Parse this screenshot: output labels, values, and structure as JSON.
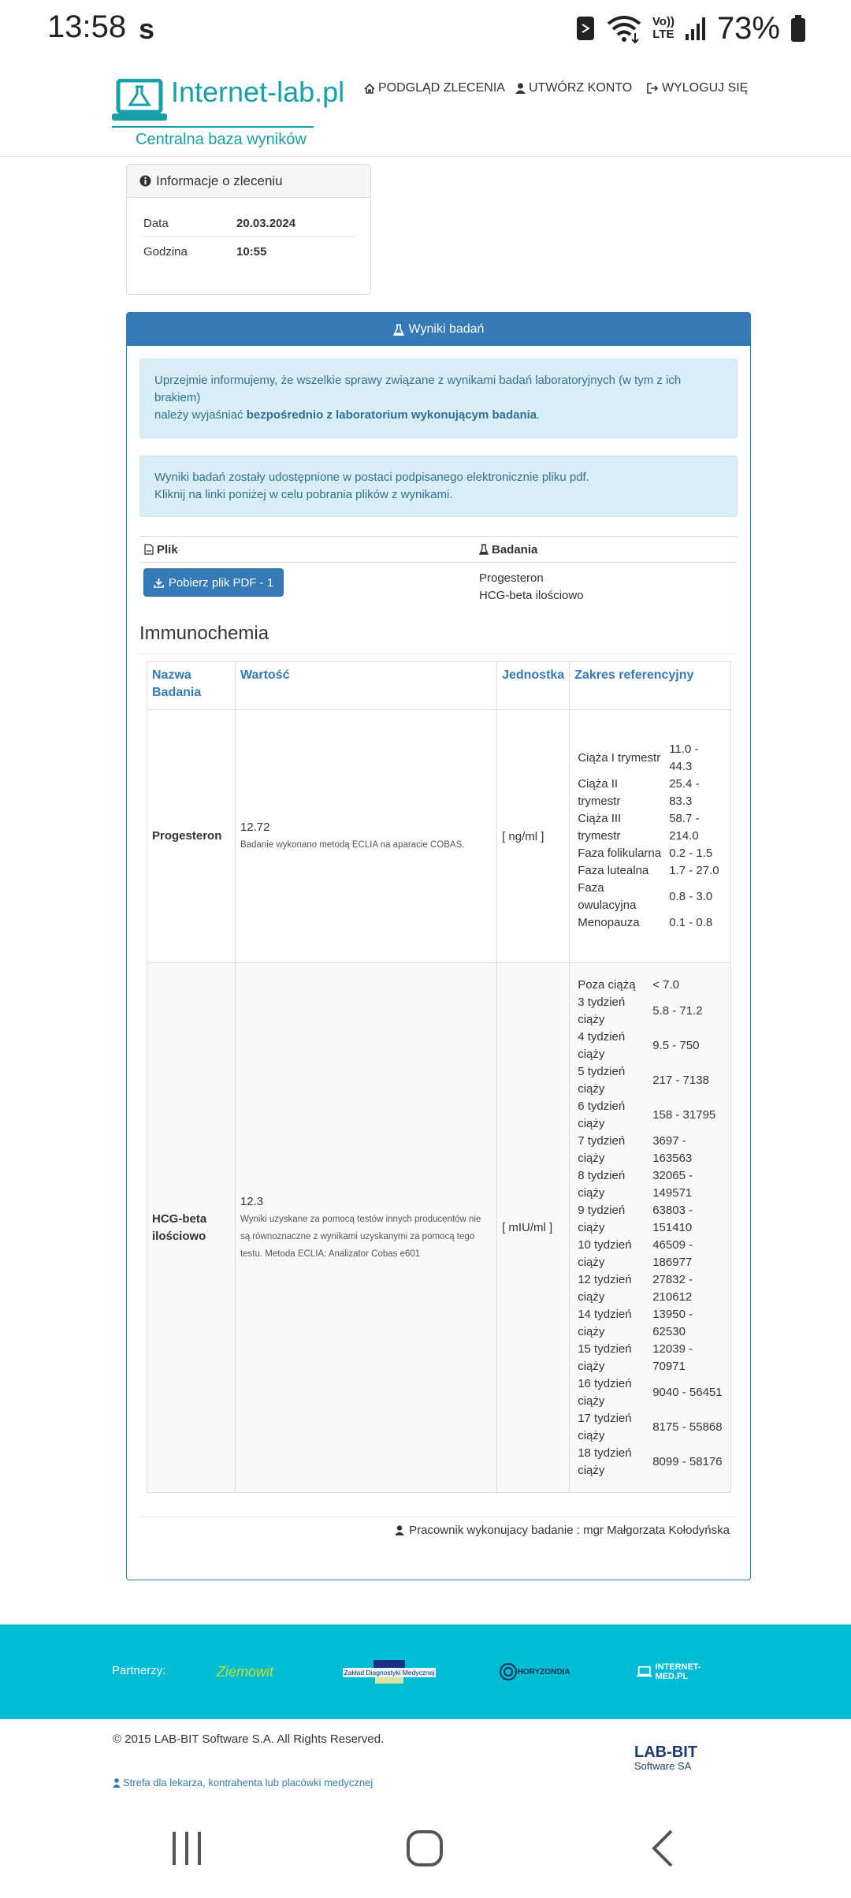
{
  "status_bar": {
    "time": "13:58",
    "carrier_icon_text": "s",
    "volte_line1": "Vo))",
    "volte_line2": "LTE",
    "battery_percent": "73%"
  },
  "header": {
    "logo_text": "Internet-lab.pl",
    "logo_subtitle": "Centralna baza wyników",
    "nav": {
      "order_preview": "PODGLĄD ZLECENIA",
      "create_account": "UTWÓRZ KONTO",
      "logout": "WYLOGUJ SIĘ"
    }
  },
  "order_info": {
    "title": "Informacje o zleceniu",
    "rows": [
      {
        "label": "Data",
        "value": "20.03.2024"
      },
      {
        "label": "Godzina",
        "value": "10:55"
      }
    ]
  },
  "results": {
    "title": "Wyniki badań",
    "alert1_line1": "Uprzejmie informujemy, że wszelkie sprawy związane z wynikami badań laboratoryjnych (w tym z ich brakiem)",
    "alert1_line2_prefix": "należy wyjaśniać ",
    "alert1_line2_bold": "bezpośrednio z laboratorium wykonującym badania",
    "alert1_line2_suffix": ".",
    "alert2_line1": "Wyniki badań zostały udostępnione w postaci podpisanego elektronicznie pliku pdf.",
    "alert2_line2": "Kliknij na linki poniżej w celu pobrania plików z wynikami.",
    "files_header_file": "Plik",
    "files_header_exams": "Badania",
    "pdf_button": "Pobierz plik PDF - 1",
    "exams": [
      "Progesteron",
      "HCG-beta ilościowo"
    ],
    "section_title": "Immunochemia",
    "table_headers": {
      "name": "Nazwa Badania",
      "value": "Wartość",
      "unit": "Jednostka",
      "range": "Zakres referencyjny"
    },
    "rows": [
      {
        "name": "Progesteron",
        "value": "12.72",
        "note": "Badanie wykonano metodą ECLIA na aparacie COBAS.",
        "unit": "[ ng/ml ]",
        "ranges": [
          {
            "label": "Ciąża I trymestr",
            "value": "11.0 - 44.3"
          },
          {
            "label": "Ciąża II trymestr",
            "value": "25.4 - 83.3"
          },
          {
            "label": "Ciąża III trymestr",
            "value": "58.7 - 214.0"
          },
          {
            "label": "Faza folikularna",
            "value": "0.2 - 1.5"
          },
          {
            "label": "Faza lutealna",
            "value": "1.7 - 27.0"
          },
          {
            "label": "Faza owulacyjna",
            "value": "0.8 - 3.0"
          },
          {
            "label": "Menopauza",
            "value": "0.1 - 0.8"
          }
        ]
      },
      {
        "name": "HCG-beta ilościowo",
        "value": "12.3",
        "note": "Wyniki uzyskane za pomocą testów innych producentów nie są równoznaczne z wynikami uzyskanymi za pomocą tego testu. Metoda ECLIA: Analizator Cobas e601",
        "unit": "[ mIU/ml ]",
        "ranges": [
          {
            "label": "Poza ciążą",
            "value": "< 7.0"
          },
          {
            "label": "3 tydzień ciąży",
            "value": "5.8 - 71.2"
          },
          {
            "label": "4 tydzień ciąży",
            "value": "9.5 - 750"
          },
          {
            "label": "5 tydzień ciąży",
            "value": "217 - 7138"
          },
          {
            "label": "6 tydzień ciąży",
            "value": "158 - 31795"
          },
          {
            "label": "7 tydzień ciąży",
            "value": "3697 - 163563"
          },
          {
            "label": "8 tydzień ciąży",
            "value": "32065 - 149571"
          },
          {
            "label": "9 tydzień ciąży",
            "value": "63803 - 151410"
          },
          {
            "label": "10 tydzień ciąży",
            "value": "46509 - 186977"
          },
          {
            "label": "12 tydzień ciąży",
            "value": "27832 - 210612"
          },
          {
            "label": "14 tydzień ciąży",
            "value": "13950 - 62530"
          },
          {
            "label": "15 tydzień ciąży",
            "value": "12039 - 70971"
          },
          {
            "label": "16 tydzień ciąży",
            "value": "9040 - 56451"
          },
          {
            "label": "17 tydzień ciąży",
            "value": "8175 - 55868"
          },
          {
            "label": "18 tydzień ciąży",
            "value": "8099 - 58176"
          }
        ]
      }
    ],
    "worker": "Pracownik wykonujacy badanie : mgr Małgorzata Kołodyńska"
  },
  "footer": {
    "partners_label": "Partnerzy:",
    "partner_logos": [
      "Ziemowit",
      "Zakład Diagnostyki Medycznej",
      "HORYZONDIA",
      "INTERNET-MED.PL"
    ],
    "copyright": "© 2015 LAB-BIT Software S.A. All Rights Reserved.",
    "labbit_logo": "LAB-BIT",
    "labbit_logo_sub": "Software SA",
    "zone_link": "Strefa dla lekarza, kontrahenta lub placówki medycznej"
  },
  "colors": {
    "brand_teal": "#16a0a8",
    "primary_blue": "#337ab7",
    "alert_bg": "#d9edf7",
    "partners_bg": "#00bcd4"
  }
}
